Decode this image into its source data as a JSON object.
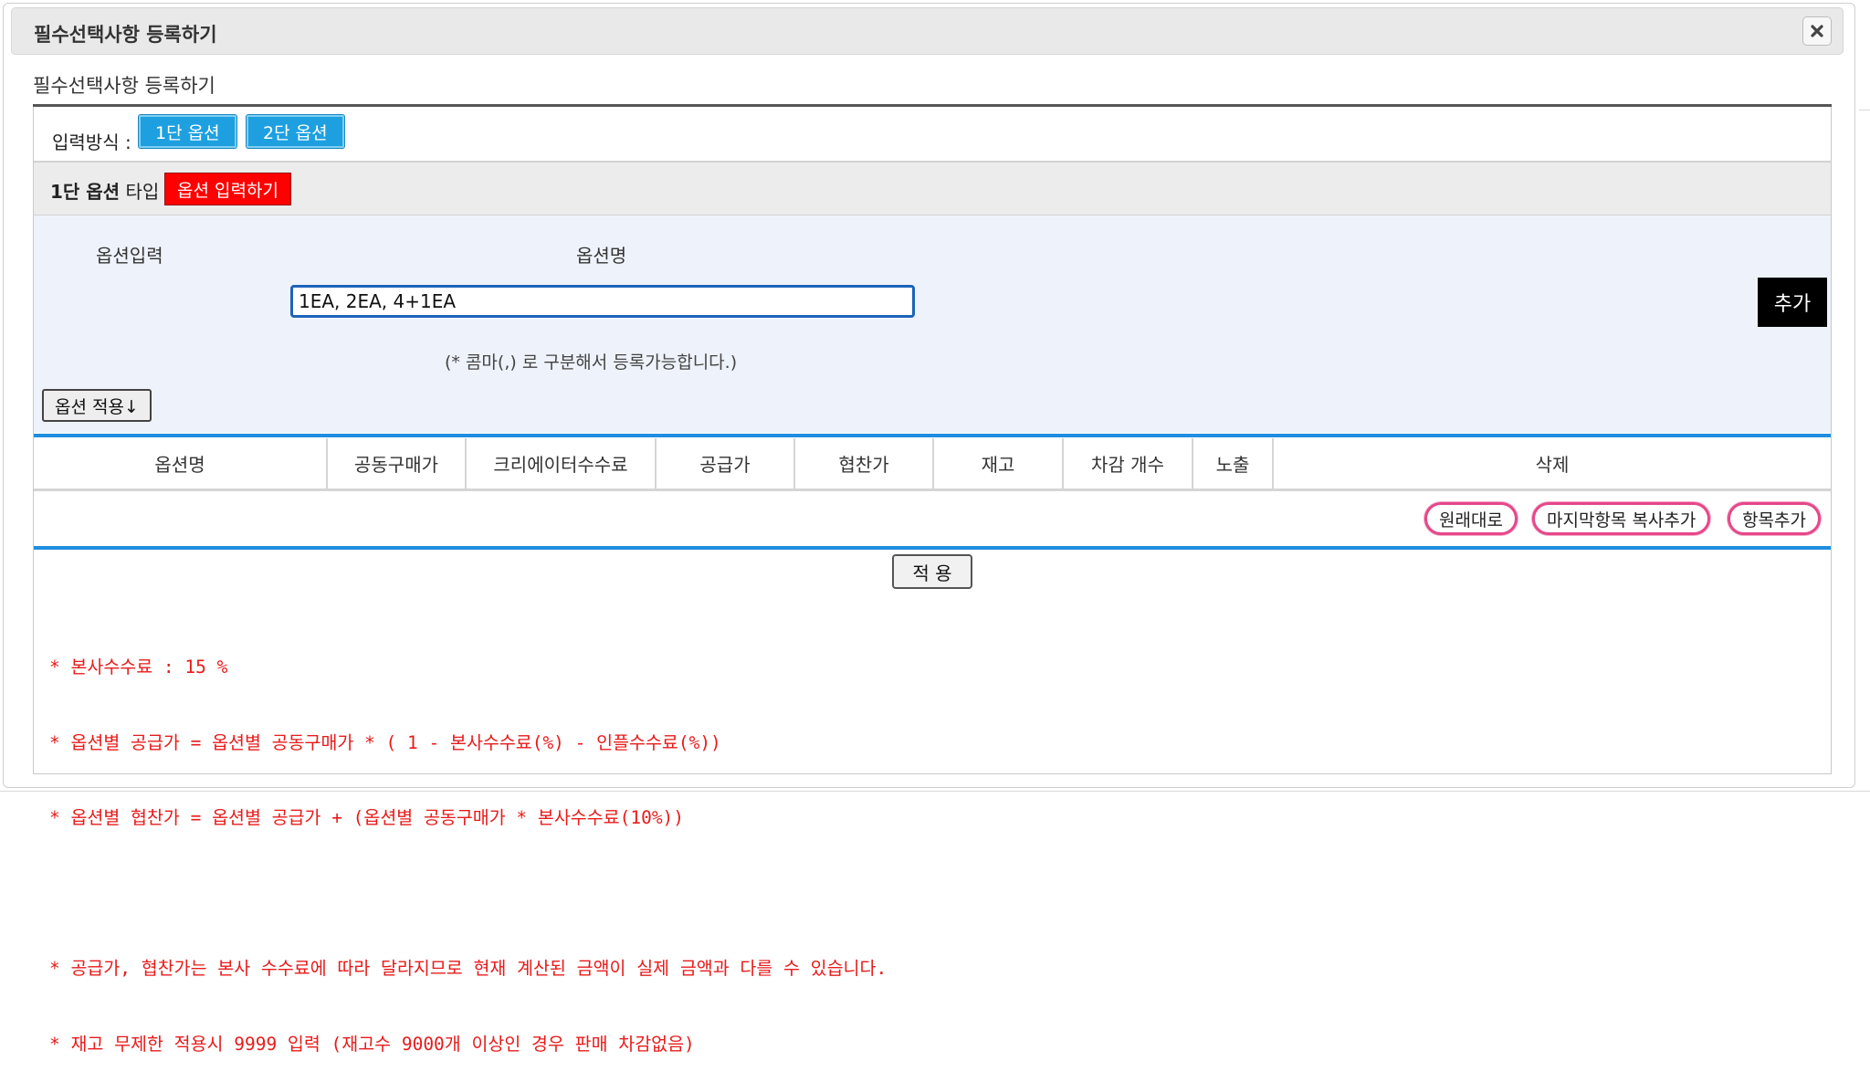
{
  "dialog": {
    "title": "필수선택사항 등록하기",
    "subtitle": "필수선택사항 등록하기",
    "close_icon": "close-icon"
  },
  "input_method": {
    "label": "입력방식 :",
    "buttons": [
      "1단 옵션",
      "2단 옵션"
    ]
  },
  "option_type": {
    "bold": "1단 옵션",
    "suffix": " 타입",
    "input_button": "옵션 입력하기"
  },
  "option_input": {
    "header_input": "옵션입력",
    "header_name": "옵션명",
    "value": "1EA, 2EA, 4+1EA",
    "add_button": "추가",
    "hint": "(* 콤마(,) 로 구분해서 등록가능합니다.)",
    "apply_button": "옵션 적용↓"
  },
  "table": {
    "columns": [
      "옵션명",
      "공동구매가",
      "크리에이터수수료",
      "공급가",
      "협찬가",
      "재고",
      "차감 개수",
      "노출",
      "삭제"
    ]
  },
  "actions": {
    "reset": "원래대로",
    "copy_last": "마지막항목 복사추가",
    "add_item": "항목추가",
    "apply": "적 용"
  },
  "notes": [
    "* 본사수수료 : 15 %",
    "* 옵션별 공급가 = 옵션별 공동구매가 * ( 1 - 본사수수료(%) - 인플수수료(%))",
    "* 옵션별 협찬가 = 옵션별 공급가 + (옵션별 공동구매가 * 본사수수료(10%))",
    "",
    "* 공급가, 협찬가는 본사 수수료에 따라 달라지므로 현재 계산된 금액이 실제 금액과 다를 수 있습니다.",
    "* 재고 무제한 적용시 9999 입력 (재고수 9000개 이상인 경우 판매 차감없음)"
  ],
  "colors": {
    "accent_blue": "#1ea0e0",
    "option_red": "#ff0000",
    "note_red": "#e81b1b",
    "pill_pink": "#e6478a",
    "separator_blue": "#1f8ee0"
  }
}
